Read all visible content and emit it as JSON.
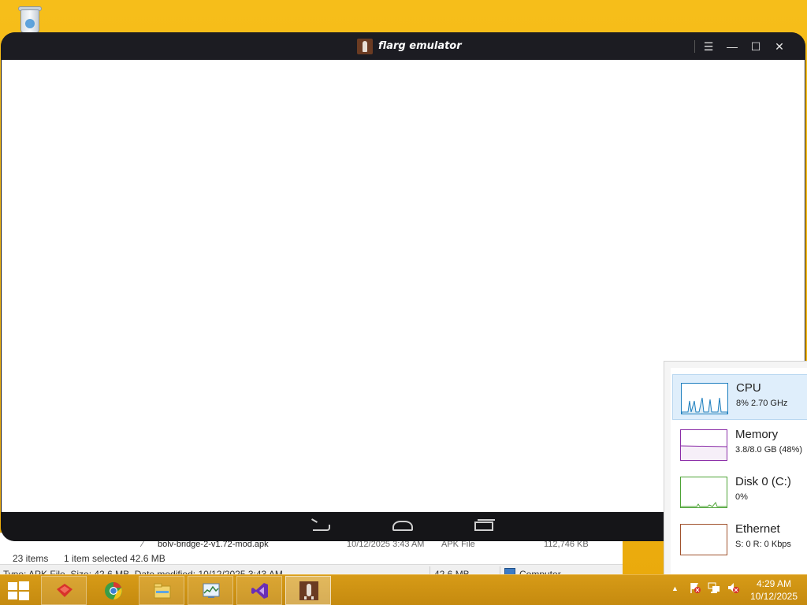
{
  "emulator": {
    "title": "flarg emulator",
    "controls": {
      "menu": "☰",
      "minimize": "—",
      "maximize": "☐",
      "close": "✕"
    }
  },
  "explorer": {
    "file_row": {
      "name": "bolv-bridge-2-v1.72-mod.apk",
      "date": "10/12/2025 3:43 AM",
      "type": "APK File",
      "size": "112,746 KB"
    },
    "status": {
      "count": "23 items",
      "selection": "1 item selected  42.6 MB"
    },
    "details_bar": {
      "info": "Type: APK File, Size: 42.6 MB, Date modified: 10/12/2025 3:43 AM",
      "size": "42.6 MB",
      "location": "Computer"
    }
  },
  "task_manager": {
    "items": [
      {
        "name": "CPU",
        "detail": "8% 2.70 GHz",
        "color": "#1e7fbf"
      },
      {
        "name": "Memory",
        "detail": "3.8/8.0 GB (48%)",
        "color": "#8b2ea8"
      },
      {
        "name": "Disk 0 (C:)",
        "detail": "0%",
        "color": "#4da336"
      },
      {
        "name": "Ethernet",
        "detail": "S: 0 R: 0 Kbps",
        "color": "#a0522d"
      }
    ]
  },
  "taskbar": {
    "pinned": [
      "windows-start-icon",
      "toolbox-icon",
      "chrome-icon",
      "file-explorer-icon",
      "task-manager-icon",
      "visual-studio-icon",
      "flarg-emulator-icon"
    ],
    "tray_arrow": "▲",
    "time": "4:29 AM",
    "date": "10/12/2025"
  }
}
